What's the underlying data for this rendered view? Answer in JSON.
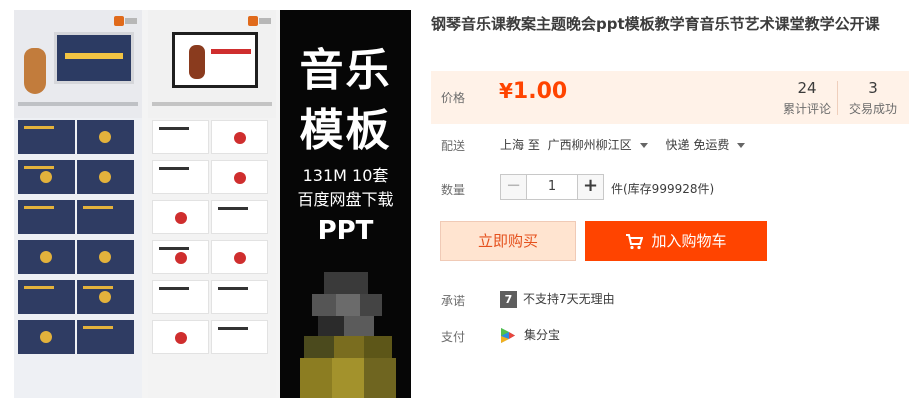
{
  "product": {
    "title": "钢琴音乐课教案主题晚会ppt模板教学育音乐节艺术课堂教学公开课",
    "poster": {
      "line1": "音乐",
      "line2": "模板",
      "size": "131M  10套",
      "download": "百度网盘下载",
      "format": "PPT"
    }
  },
  "price": {
    "label": "价格",
    "currency": "¥",
    "value": "1.00",
    "reviews_count": "24",
    "reviews_label": "累计评论",
    "trades_count": "3",
    "trades_label": "交易成功"
  },
  "shipping": {
    "label": "配送",
    "from": "上海 至",
    "to": "广西柳州柳江区",
    "method": "快递 免运费"
  },
  "quantity": {
    "label": "数量",
    "value": "1",
    "minus": "−",
    "plus": "+",
    "stock": "件(库存999928件)"
  },
  "actions": {
    "buy_now": "立即购买",
    "add_to_cart": "加入购物车"
  },
  "promise": {
    "label": "承诺",
    "icon_text": "7",
    "text": "不支持7天无理由"
  },
  "payment": {
    "label": "支付",
    "method": "集分宝"
  },
  "colors": {
    "accent": "#ff4400",
    "price_bg": "#fff2e8",
    "buy_now_bg": "#ffe4d0"
  },
  "icons": [
    "cart-icon",
    "seven-day-icon",
    "jifenbao-icon",
    "caret-down-icon"
  ]
}
